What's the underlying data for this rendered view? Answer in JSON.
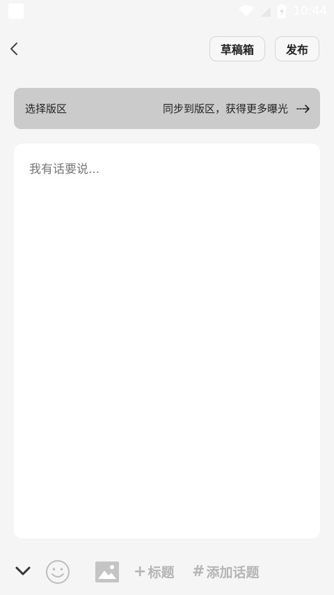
{
  "status_bar": {
    "time": "10:44"
  },
  "header": {
    "draft_label": "草稿箱",
    "publish_label": "发布"
  },
  "section_selector": {
    "label": "选择版区",
    "hint": "同步到版区，获得更多曝光"
  },
  "editor": {
    "placeholder": "我有话要说..."
  },
  "toolbar": {
    "title_label": "标题",
    "topic_label": "添加话题"
  },
  "colors": {
    "background": "#f5f5f5",
    "section_bg": "#cbcbcb",
    "toolbar_muted": "#b5b5b5"
  }
}
